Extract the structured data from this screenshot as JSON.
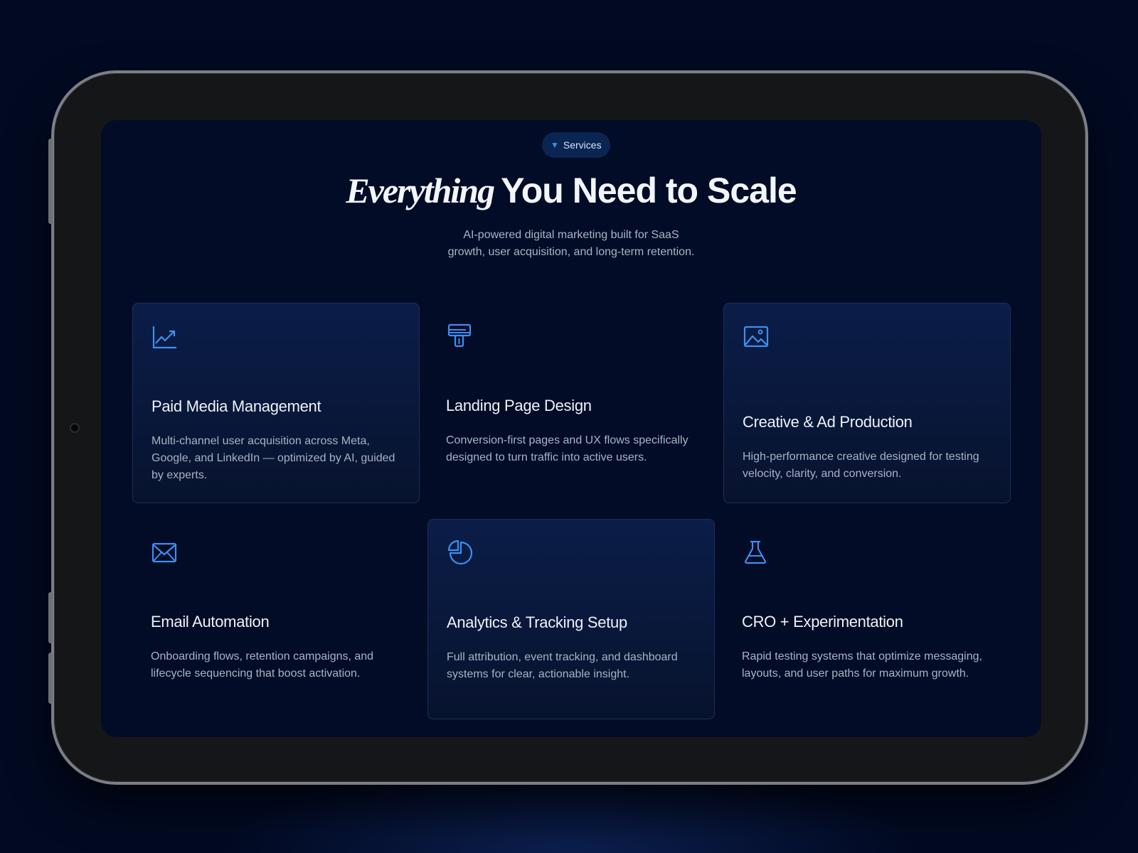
{
  "badge": {
    "label": "Services"
  },
  "hero": {
    "title_italic": "Everything",
    "title_rest": "You Need to Scale",
    "subtitle_line1": "AI-powered digital marketing built for SaaS",
    "subtitle_line2": "growth, user acquisition, and long-term retention."
  },
  "services": [
    {
      "icon": "trend-chart-icon",
      "title": "Paid Media Management",
      "description": "Multi-channel user acquisition across Meta, Google, and LinkedIn — optimized by AI, guided by experts."
    },
    {
      "icon": "paint-roller-icon",
      "title": "Landing Page Design",
      "description": "Conversion-first pages and UX flows specifically designed to turn traffic into active users."
    },
    {
      "icon": "image-icon",
      "title": "Creative & Ad Production",
      "description": "High-performance creative designed for testing velocity, clarity, and conversion."
    },
    {
      "icon": "envelope-icon",
      "title": "Email Automation",
      "description": "Onboarding flows, retention campaigns, and lifecycle sequencing that boost activation."
    },
    {
      "icon": "pie-chart-icon",
      "title": "Analytics & Tracking Setup",
      "description": "Full attribution, event tracking, and dashboard systems for clear, actionable insight."
    },
    {
      "icon": "flask-icon",
      "title": "CRO + Experimentation",
      "description": "Rapid testing systems that optimize messaging, layouts, and user paths for maximum growth."
    }
  ],
  "colors": {
    "accent": "#3e8ef0",
    "background": "#030c26",
    "card": "#0b1d48"
  }
}
